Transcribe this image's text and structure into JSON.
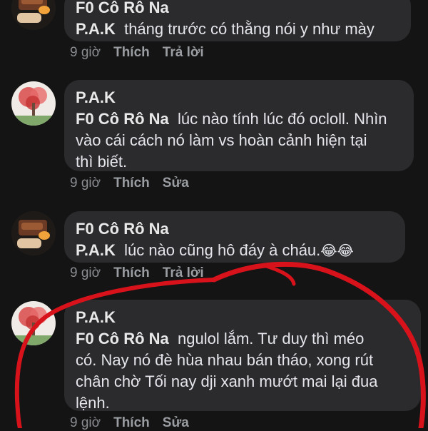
{
  "comments": [
    {
      "author": "F0 Cô Rô Na",
      "mention": "P.A.K",
      "text": "tháng trước có thằng nói y như mày",
      "time": "9 giờ",
      "actions": [
        "Thích",
        "Trả lời"
      ],
      "avatar": "food-avatar"
    },
    {
      "author": "P.A.K",
      "mention": "F0 Cô Rô Na",
      "text_lines": [
        "lúc nào tính lúc đó ocloll. Nhìn",
        "vào cái cách nó làm vs hoàn cảnh hiện tại",
        "thì biết."
      ],
      "time": "9 giờ",
      "actions": [
        "Thích",
        "Sửa"
      ],
      "avatar": "tree-avatar"
    },
    {
      "author": "F0 Cô Rô Na",
      "mention": "P.A.K",
      "text": "lúc nào cũng hô đáy à cháu.",
      "emojis": "😂😂",
      "time": "9 giờ",
      "actions": [
        "Thích",
        "Trả lời"
      ],
      "avatar": "food-avatar"
    },
    {
      "author": "P.A.K",
      "mention": "F0 Cô Rô Na",
      "text_lines": [
        "ngulol lắm. Tư duy thì méo",
        "có. Nay nó đè hùa nhau bán tháo, xong rút",
        "chân chờ Tối nay dji xanh mướt mai lại đua",
        "lệnh."
      ],
      "time": "9 giờ",
      "actions": [
        "Thích",
        "Sửa"
      ],
      "avatar": "tree-avatar"
    }
  ],
  "colors": {
    "background": "#141414",
    "bubble": "#2b2b2d",
    "meta": "#8a8d91",
    "annotation": "#d8121b"
  }
}
